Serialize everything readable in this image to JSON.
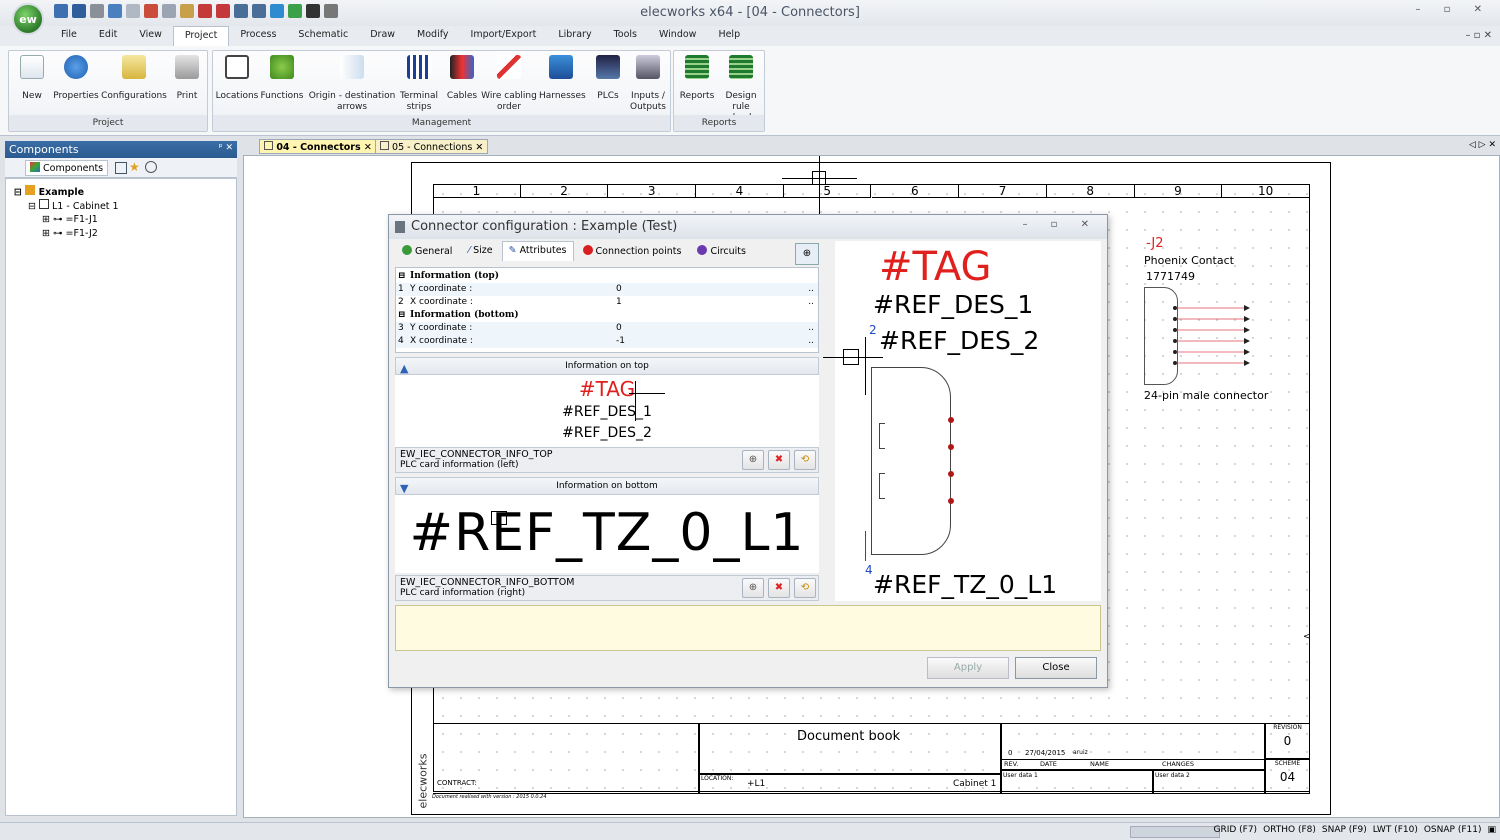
{
  "app": {
    "title": "elecworks x64 - [04 - Connectors]",
    "logo": "ew",
    "window_controls": "–  ▫  ✕",
    "mdi_controls": "– ▫ ✕"
  },
  "menu": [
    "File",
    "Edit",
    "View",
    "Project",
    "Process",
    "Schematic",
    "Draw",
    "Modify",
    "Import/Export",
    "Library",
    "Tools",
    "Window",
    "Help"
  ],
  "menu_active": "Project",
  "ribbon": {
    "groups": [
      {
        "label": "Project",
        "buttons": [
          "New",
          "Properties",
          "Configurations",
          "Print"
        ]
      },
      {
        "label": "Management",
        "buttons": [
          "Locations",
          "Functions",
          "Origin - destination arrows",
          "Terminal strips",
          "Cables",
          "Wire cabling order",
          "Harnesses",
          "PLCs",
          "Inputs / Outputs"
        ]
      },
      {
        "label": "Reports",
        "buttons": [
          "Reports",
          "Design rule check"
        ]
      }
    ]
  },
  "components_panel": {
    "title": "Components",
    "pin": "ᵖ ✕",
    "tab": "Components",
    "tree": [
      "Example",
      "L1 - Cabinet 1",
      "=F1-J1",
      "=F1-J2"
    ]
  },
  "doc_tabs": [
    {
      "label": "04 - Connectors",
      "active": true
    },
    {
      "label": "05 - Connections",
      "active": false
    }
  ],
  "doc_tab_nav": "◁ ▷ ✕",
  "sheet": {
    "columns": [
      "1",
      "2",
      "3",
      "4",
      "5",
      "6",
      "7",
      "8",
      "9",
      "10"
    ],
    "component_tag": "-J2",
    "manufacturer": "Phoenix Contact",
    "part_number": "1771749",
    "description": "24-pin male connector",
    "vertical_brand": "elecworks",
    "title_block": {
      "document": "Document book",
      "revision_label": "REVISION",
      "revision": "0",
      "rev_row": {
        "rev": "0",
        "date": "27/04/2015",
        "name": "aruiz"
      },
      "headers": {
        "rev": "REV.",
        "date": "DATE",
        "name": "NAME",
        "changes": "CHANGES"
      },
      "scheme_label": "SCHEME",
      "scheme": "04",
      "user_data_1": "User data 1",
      "user_data_2": "User data 2",
      "contract": "CONTRACT:",
      "location_label": "LOCATION:",
      "location": "+L1",
      "cabinet": "Cabinet 1",
      "footer_note": "Document realised with version : 2015 0.0.24"
    }
  },
  "dialog": {
    "title": "Connector configuration : Example (Test)",
    "controls": "– ▫ ✕",
    "tabs": [
      "General",
      "Size",
      "Attributes",
      "Connection points",
      "Circuits"
    ],
    "active_tab": "Attributes",
    "properties": {
      "section_top": "Information (top)",
      "section_bottom": "Information (bottom)",
      "rows": [
        {
          "n": "1",
          "label": "Y coordinate :",
          "value": "0"
        },
        {
          "n": "2",
          "label": "X coordinate :",
          "value": "1"
        },
        {
          "n": "3",
          "label": "Y coordinate :",
          "value": "0"
        },
        {
          "n": "4",
          "label": "X coordinate :",
          "value": "-1"
        }
      ],
      "dots": ".."
    },
    "info_top_label": "Information on top",
    "info_bottom_label": "Information on bottom",
    "preview_top": [
      "#TAG",
      "#REF_DES_1",
      "#REF_DES_2"
    ],
    "top_block_name": "EW_IEC_CONNECTOR_INFO_TOP",
    "top_block_desc": "PLC card information (left)",
    "preview_bottom": "#REF_TZ_0_L1",
    "bottom_block_name": "EW_IEC_CONNECTOR_INFO_BOTTOM",
    "bottom_block_desc": "PLC card information (right)",
    "right_preview": {
      "tag": "#TAG",
      "ref1": "#REF_DES_1",
      "ref2": "#REF_DES_2",
      "bottom": "#REF_TZ_0_L1",
      "num_top": "2",
      "num_bottom": "4"
    },
    "apply": "Apply",
    "close": "Close"
  },
  "status": [
    "GRID (F7)",
    "ORTHO (F8)",
    "SNAP (F9)",
    "LWT (F10)",
    "OSNAP (F11)"
  ],
  "colors": {
    "accent": "#2a5a90",
    "tag_red": "#e0201c",
    "selection_blue": "#1f49c7"
  }
}
